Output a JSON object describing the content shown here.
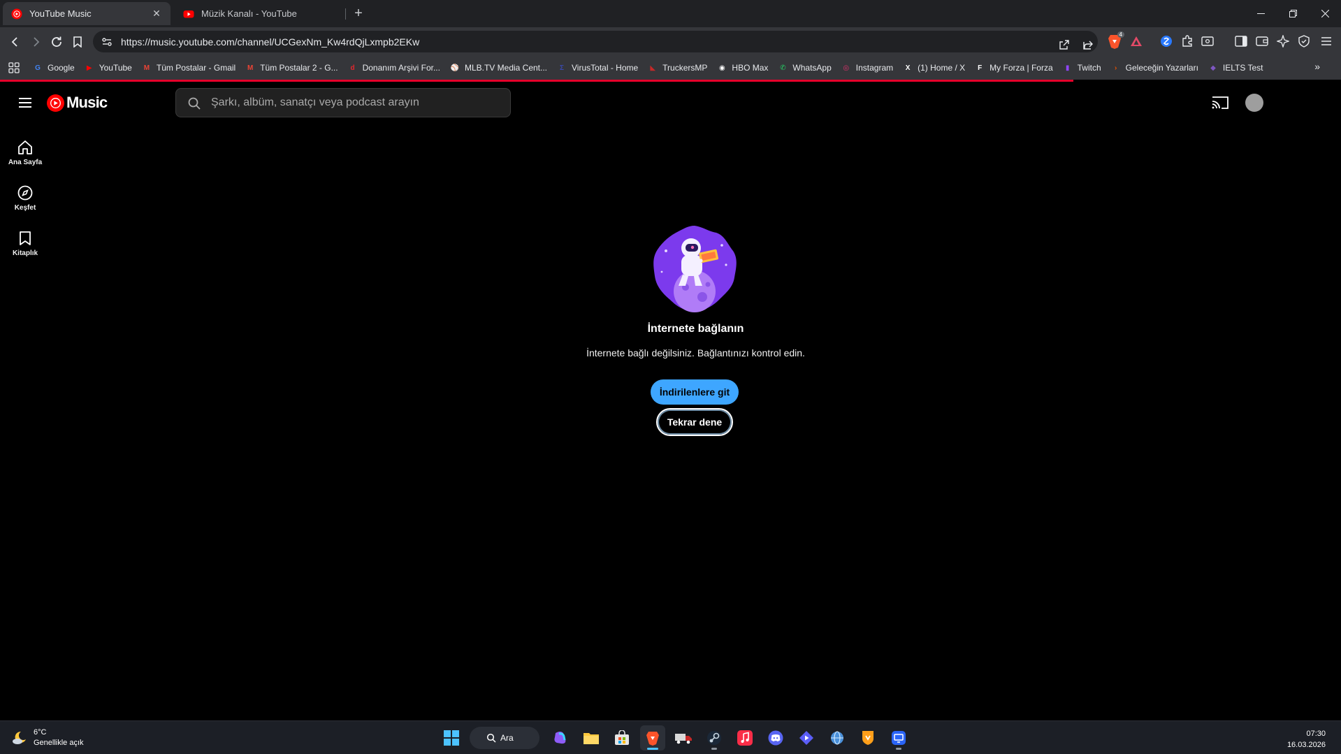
{
  "browser": {
    "tabs": [
      {
        "title": "YouTube Music",
        "active": true
      },
      {
        "title": "Müzik Kanalı - YouTube",
        "active": false
      }
    ],
    "url": "https://music.youtube.com/channel/UCGexNm_Kw4rdQjLxmpb2EKw",
    "brave_badge": "4",
    "bookmarks": [
      {
        "label": "Google",
        "icon": "google-icon",
        "color": "#4285f4"
      },
      {
        "label": "YouTube",
        "icon": "youtube-icon",
        "color": "#ff0000"
      },
      {
        "label": "Tüm Postalar - Gmail",
        "icon": "gmail-icon",
        "color": "#ea4335"
      },
      {
        "label": "Tüm Postalar 2 - G...",
        "icon": "gmail-icon",
        "color": "#ea4335"
      },
      {
        "label": "Donanım Arşivi For...",
        "icon": "donanim-icon",
        "color": "#e0282e"
      },
      {
        "label": "MLB.TV Media Cent...",
        "icon": "mlb-icon",
        "color": "#1a3a7a"
      },
      {
        "label": "VirusTotal - Home",
        "icon": "virustotal-icon",
        "color": "#3949ab"
      },
      {
        "label": "TruckersMP",
        "icon": "truckersmp-icon",
        "color": "#c62828"
      },
      {
        "label": "HBO Max",
        "icon": "hbo-icon",
        "color": "#ffffff"
      },
      {
        "label": "WhatsApp",
        "icon": "whatsapp-icon",
        "color": "#25d366"
      },
      {
        "label": "Instagram",
        "icon": "instagram-icon",
        "color": "#e1306c"
      },
      {
        "label": "(1) Home / X",
        "icon": "x-icon",
        "color": "#ffffff"
      },
      {
        "label": "My Forza | Forza",
        "icon": "forza-icon",
        "color": "#ffffff"
      },
      {
        "label": "Twitch",
        "icon": "twitch-icon",
        "color": "#9146ff"
      },
      {
        "label": "Geleceğin Yazarları",
        "icon": "yazarlar-icon",
        "color": "#e65100"
      },
      {
        "label": "IELTS Test",
        "icon": "ielts-icon",
        "color": "#7e57c2"
      }
    ]
  },
  "app": {
    "logo_text": "Music",
    "search_placeholder": "Şarkı, albüm, sanatçı veya podcast arayın",
    "sidebar": [
      {
        "label": "Ana Sayfa",
        "icon": "home-icon"
      },
      {
        "label": "Keşfet",
        "icon": "compass-icon"
      },
      {
        "label": "Kitaplık",
        "icon": "library-icon"
      }
    ],
    "offline": {
      "heading": "İnternete bağlanın",
      "message": "İnternete bağlı değilsiniz. Bağlantınızı kontrol edin.",
      "primary_button": "İndirilenlere git",
      "secondary_button": "Tekrar dene"
    },
    "colors": {
      "accent": "#3ea6ff",
      "brand": "#ff0000",
      "illustration": "#7c3aed"
    }
  },
  "taskbar": {
    "weather_temp": "6°C",
    "weather_desc": "Genellikle açık",
    "search_label": "Ara",
    "time": "07:30",
    "date": "16.03.2026"
  }
}
